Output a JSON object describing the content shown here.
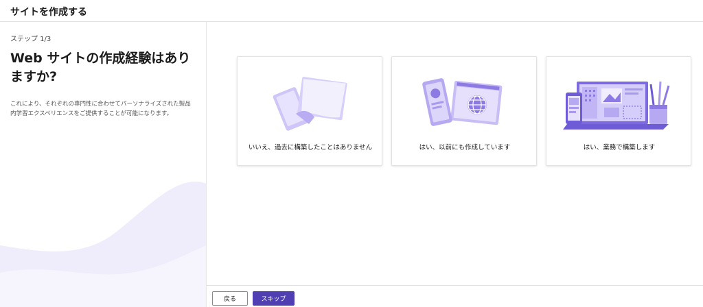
{
  "header": {
    "title": "サイトを作成する"
  },
  "left": {
    "step": "ステップ 1/3",
    "question": "Web サイトの作成経験はありますか?",
    "description": "これにより、それぞれの専門性に合わせてパーソナライズされた製品内学習エクスペリエンスをご提供することが可能になります。"
  },
  "options": [
    {
      "label": "いいえ、過去に構築したことはありません",
      "icon": "blank-pages-illustration"
    },
    {
      "label": "はい、以前にも作成しています",
      "icon": "globe-devices-illustration"
    },
    {
      "label": "はい、業務で構築します",
      "icon": "design-workspace-illustration"
    }
  ],
  "footer": {
    "back_label": "戻る",
    "skip_label": "スキップ"
  },
  "colors": {
    "accent": "#4f3fb3",
    "illustration_light": "#ddd6fb",
    "illustration_mid": "#a999ee",
    "illustration_dark": "#6e5bd6"
  }
}
